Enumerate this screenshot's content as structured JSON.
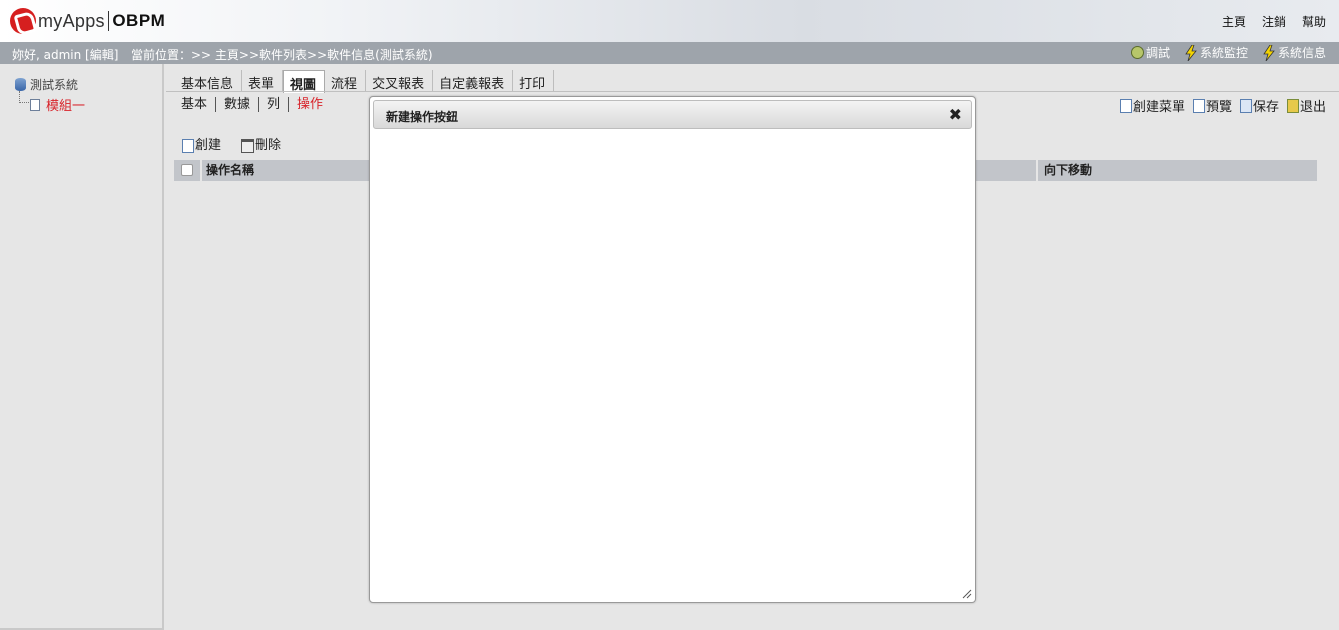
{
  "header": {
    "logo_text": "myApps",
    "logo_text2": "OBPM",
    "nav": [
      "主頁",
      "注銷",
      "幫助"
    ]
  },
  "infobar": {
    "greeting": "妳好, admin [編輯]",
    "breadcrumb": "當前位置：>> 主頁>>軟件列表>>軟件信息(測試系統)",
    "tools": [
      {
        "label": "調試",
        "icon": "bug-icon"
      },
      {
        "label": "系統監控",
        "icon": "lightning-icon"
      },
      {
        "label": "系統信息",
        "icon": "lightning-icon"
      }
    ]
  },
  "tree": {
    "root": "測試系統",
    "child": "模組一"
  },
  "tabs": [
    "基本信息",
    "表單",
    "視圖",
    "流程",
    "交叉報表",
    "自定義報表",
    "打印"
  ],
  "active_tab": "視圖",
  "subtabs": [
    "基本",
    "數據",
    "列",
    "操作"
  ],
  "active_subtab": "操作",
  "actions": [
    {
      "label": "創建菜單",
      "icon": "create-menu-icon"
    },
    {
      "label": "預覽",
      "icon": "preview-icon"
    },
    {
      "label": "保存",
      "icon": "save-icon"
    },
    {
      "label": "退出",
      "icon": "exit-icon"
    }
  ],
  "toolbar": {
    "create_label": "創建",
    "delete_label": "刪除"
  },
  "table": {
    "columns": [
      "操作名稱",
      "向下移動"
    ]
  },
  "modal": {
    "title": "新建操作按鈕",
    "close_glyph": "✖"
  },
  "colors": {
    "accent_red": "#d8232a",
    "infobar_bg": "#9ea4ab",
    "table_header_bg": "#c2c5ca"
  }
}
